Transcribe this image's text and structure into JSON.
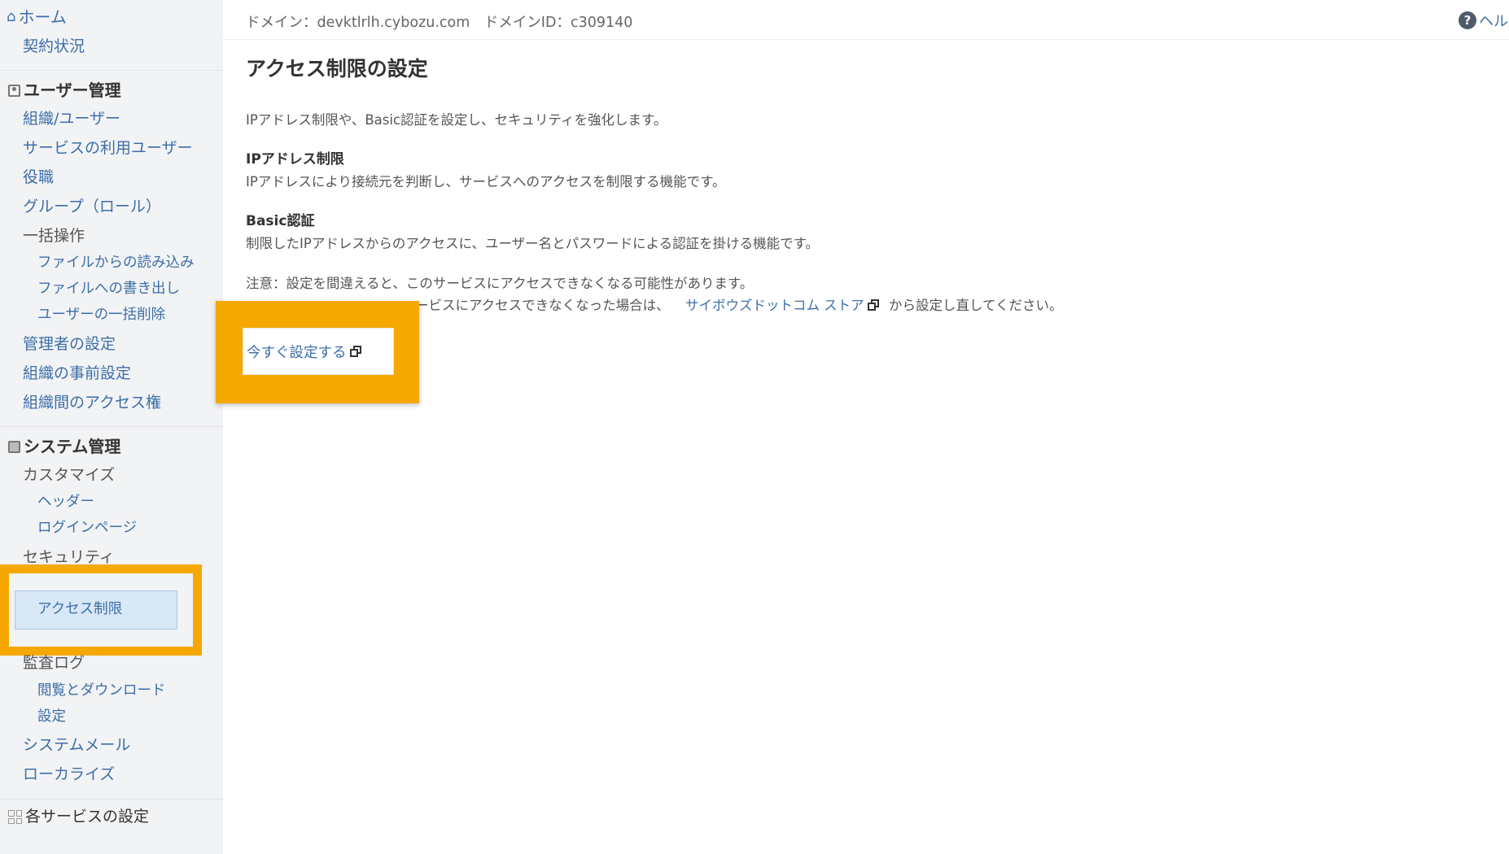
{
  "header": {
    "domain_text": "ドメイン：devktlrlh.cybozu.com　ドメインID：c309140",
    "help_label": "ヘルプ"
  },
  "sidebar": {
    "home": "ホーム",
    "contract": "契約状況",
    "user_management": {
      "title": "ユーザー管理",
      "items": [
        "組織/ユーザー",
        "サービスの利用ユーザー",
        "役職",
        "グループ（ロール）",
        "一括操作"
      ],
      "bulk_sub": [
        "ファイルからの読み込み",
        "ファイルへの書き出し",
        "ユーザーの一括削除"
      ],
      "items_after": [
        "管理者の設定",
        "組織の事前設定",
        "組織間のアクセス権"
      ]
    },
    "system_management": {
      "title": "システム管理",
      "customize": "カスタマイズ",
      "customize_sub": [
        "ヘッダー",
        "ログインページ"
      ],
      "security": "セキュリティ",
      "access_restriction": "アクセス制限",
      "audit_log": "監査ログ",
      "audit_sub": [
        "閲覧とダウンロード",
        "設定"
      ],
      "system_mail": "システムメール",
      "localize": "ローカライズ"
    },
    "service_settings": "各サービスの設定"
  },
  "main": {
    "title": "アクセス制限の設定",
    "intro": "IPアドレス制限や、Basic認証を設定し、セキュリティを強化します。",
    "ip": {
      "title": "IPアドレス制限",
      "desc": "IPアドレスにより接続元を判断し、サービスへのアクセスを制限する機能です。"
    },
    "basic": {
      "title": "Basic認証",
      "desc": "制限したIPアドレスからのアクセスに、ユーザー名とパスワードによる認証を掛ける機能です。"
    },
    "note": {
      "line1": "注意：設定を間違えると、このサービスにアクセスできなくなる可能性があります。",
      "line2_prefix": "ービスにアクセスできなくなった場合は、",
      "store_link": "サイボウズドットコム ストア",
      "line2_suffix": "から設定し直してください。"
    },
    "setup_button": "今すぐ設定する"
  },
  "colors": {
    "highlight": "#f5a800",
    "link": "#3d6ea8",
    "sidebar_bg": "#f2f3f5",
    "selected_bg": "#d8e8f7"
  }
}
